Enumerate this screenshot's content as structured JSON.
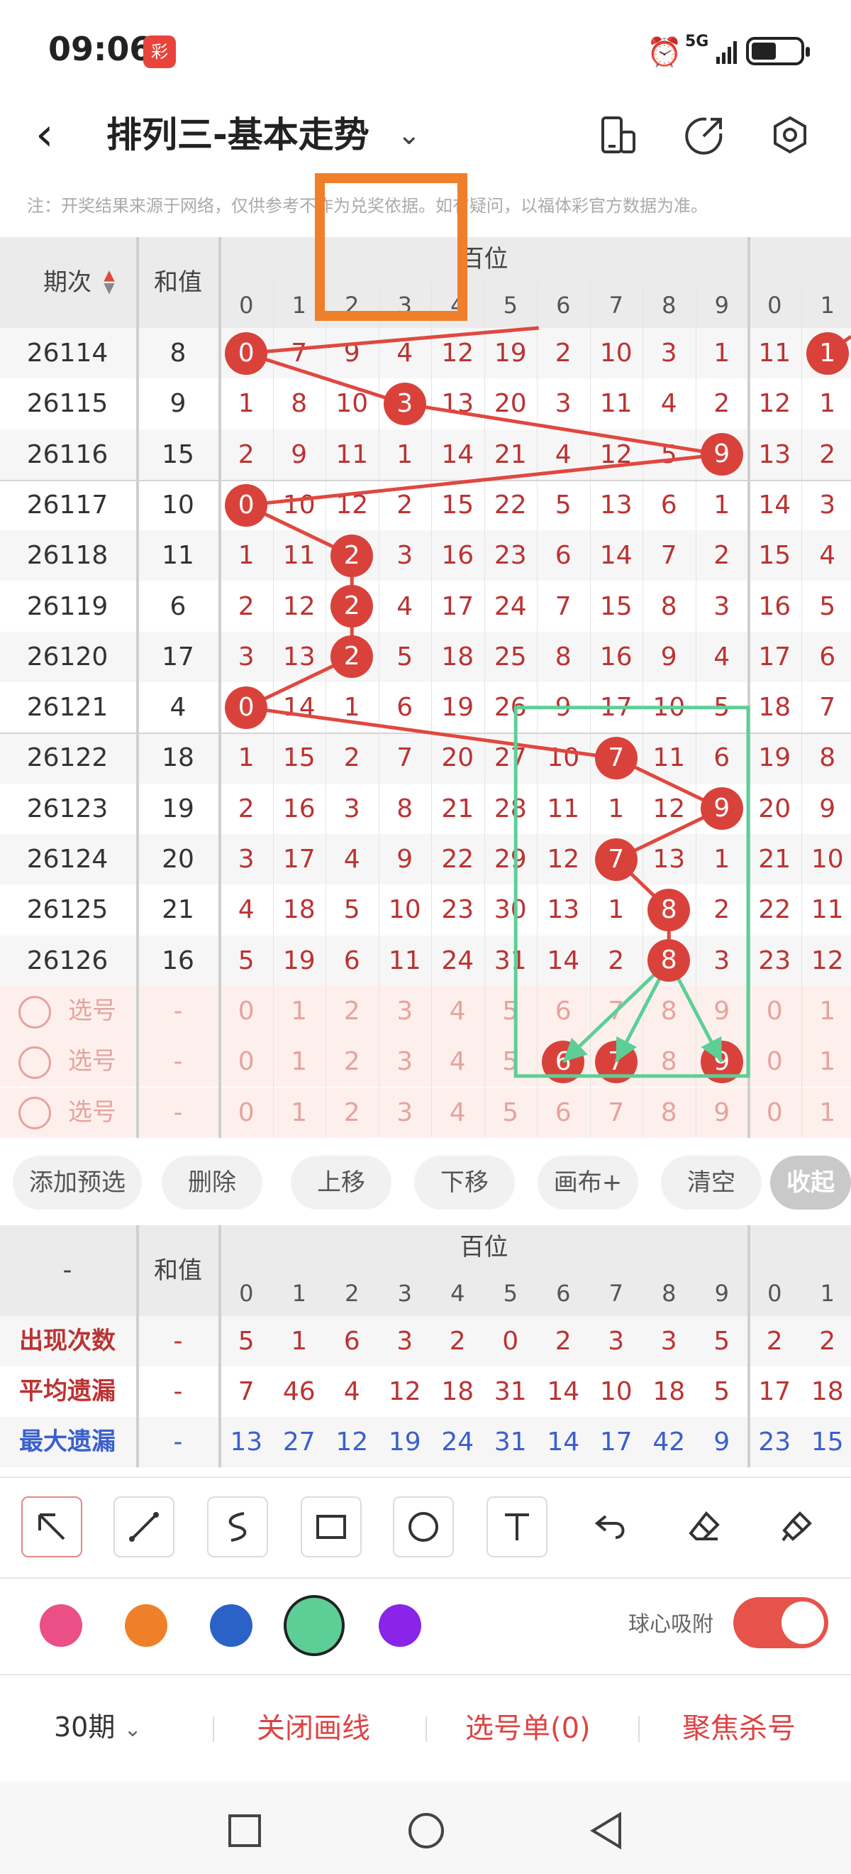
{
  "status": {
    "time": "09:06",
    "network": "5G"
  },
  "header": {
    "title": "排列三-基本走势",
    "note": "注：开奖结果来源于网络，仅供参考不作为兑奖依据。如有疑问，以福体彩官方数据为准。"
  },
  "table": {
    "col_period": "期次",
    "col_sum": "和值",
    "group_label": "百位",
    "digits": [
      "0",
      "1",
      "2",
      "3",
      "4",
      "5",
      "6",
      "7",
      "8",
      "9",
      "0",
      "1"
    ],
    "rows": [
      {
        "period": "26114",
        "sum": "8",
        "cells": [
          "0",
          "7",
          "9",
          "4",
          "12",
          "19",
          "2",
          "10",
          "3",
          "1",
          "11",
          "1"
        ],
        "hit": 0
      },
      {
        "period": "26115",
        "sum": "9",
        "cells": [
          "1",
          "8",
          "10",
          "3",
          "13",
          "20",
          "3",
          "11",
          "4",
          "2",
          "12",
          "1"
        ],
        "hit": 3
      },
      {
        "period": "26116",
        "sum": "15",
        "cells": [
          "2",
          "9",
          "11",
          "1",
          "14",
          "21",
          "4",
          "12",
          "5",
          "9",
          "13",
          "2"
        ],
        "hit": 9
      },
      {
        "period": "26117",
        "sum": "10",
        "cells": [
          "0",
          "10",
          "12",
          "2",
          "15",
          "22",
          "5",
          "13",
          "6",
          "1",
          "14",
          "3"
        ],
        "hit": 0
      },
      {
        "period": "26118",
        "sum": "11",
        "cells": [
          "1",
          "11",
          "2",
          "3",
          "16",
          "23",
          "6",
          "14",
          "7",
          "2",
          "15",
          "4"
        ],
        "hit": 2
      },
      {
        "period": "26119",
        "sum": "6",
        "cells": [
          "2",
          "12",
          "2",
          "4",
          "17",
          "24",
          "7",
          "15",
          "8",
          "3",
          "16",
          "5"
        ],
        "hit": 2
      },
      {
        "period": "26120",
        "sum": "17",
        "cells": [
          "3",
          "13",
          "2",
          "5",
          "18",
          "25",
          "8",
          "16",
          "9",
          "4",
          "17",
          "6"
        ],
        "hit": 2
      },
      {
        "period": "26121",
        "sum": "4",
        "cells": [
          "0",
          "14",
          "1",
          "6",
          "19",
          "26",
          "9",
          "17",
          "10",
          "5",
          "18",
          "7"
        ],
        "hit": 0
      },
      {
        "period": "26122",
        "sum": "18",
        "cells": [
          "1",
          "15",
          "2",
          "7",
          "20",
          "27",
          "10",
          "7",
          "11",
          "6",
          "19",
          "8"
        ],
        "hit": 7
      },
      {
        "period": "26123",
        "sum": "19",
        "cells": [
          "2",
          "16",
          "3",
          "8",
          "21",
          "28",
          "11",
          "1",
          "12",
          "9",
          "20",
          "9"
        ],
        "hit": 9
      },
      {
        "period": "26124",
        "sum": "20",
        "cells": [
          "3",
          "17",
          "4",
          "9",
          "22",
          "29",
          "12",
          "7",
          "13",
          "1",
          "21",
          "10"
        ],
        "hit": 7
      },
      {
        "period": "26125",
        "sum": "21",
        "cells": [
          "4",
          "18",
          "5",
          "10",
          "23",
          "30",
          "13",
          "1",
          "8",
          "2",
          "22",
          "11"
        ],
        "hit": 8
      },
      {
        "period": "26126",
        "sum": "16",
        "cells": [
          "5",
          "19",
          "6",
          "11",
          "24",
          "31",
          "14",
          "2",
          "8",
          "3",
          "23",
          "12"
        ],
        "hit": 8
      }
    ],
    "select_rows": [
      {
        "label": "选号",
        "sum": "-",
        "cells": [
          "0",
          "1",
          "2",
          "3",
          "4",
          "5",
          "6",
          "7",
          "8",
          "9",
          "0",
          "1"
        ],
        "picked": []
      },
      {
        "label": "选号",
        "sum": "-",
        "cells": [
          "0",
          "1",
          "2",
          "3",
          "4",
          "5",
          "6",
          "7",
          "8",
          "9",
          "0",
          "1"
        ],
        "picked": [
          6,
          7,
          9
        ]
      },
      {
        "label": "选号",
        "sum": "-",
        "cells": [
          "0",
          "1",
          "2",
          "3",
          "4",
          "5",
          "6",
          "7",
          "8",
          "9",
          "0",
          "1"
        ],
        "picked": []
      }
    ]
  },
  "buttons": [
    "添加预选",
    "删除",
    "上移",
    "下移",
    "画布+",
    "清空",
    "收起"
  ],
  "stats": {
    "corner": "-",
    "col_sum": "和值",
    "group_label": "百位",
    "digits": [
      "0",
      "1",
      "2",
      "3",
      "4",
      "5",
      "6",
      "7",
      "8",
      "9",
      "0",
      "1"
    ],
    "rows": [
      {
        "label": "出现次数",
        "sum": "-",
        "values": [
          "5",
          "1",
          "6",
          "3",
          "2",
          "0",
          "2",
          "3",
          "3",
          "5",
          "2",
          "2"
        ],
        "color": "#b33"
      },
      {
        "label": "平均遗漏",
        "sum": "-",
        "values": [
          "7",
          "46",
          "4",
          "12",
          "18",
          "31",
          "14",
          "10",
          "18",
          "5",
          "17",
          "18"
        ],
        "color": "#b33"
      },
      {
        "label": "最大遗漏",
        "sum": "-",
        "values": [
          "13",
          "27",
          "12",
          "19",
          "24",
          "31",
          "14",
          "17",
          "42",
          "9",
          "23",
          "15"
        ],
        "color": "#3a5fcd"
      }
    ]
  },
  "tools": [
    "arrow-icon",
    "line-icon",
    "curve-icon",
    "rectangle-icon",
    "circle-icon",
    "text-icon",
    "undo-icon",
    "eraser-icon",
    "brush-icon"
  ],
  "colors": [
    "#ea4f86",
    "#f07f2a",
    "#2b62c8",
    "#5dcf96",
    "#8a24e8"
  ],
  "snap_label": "球心吸附",
  "actions": {
    "period": "30期",
    "close_lines": "关闭画线",
    "selection": "选号单(0)",
    "focus_kill": "聚焦杀号"
  },
  "accent": "#e0483f"
}
